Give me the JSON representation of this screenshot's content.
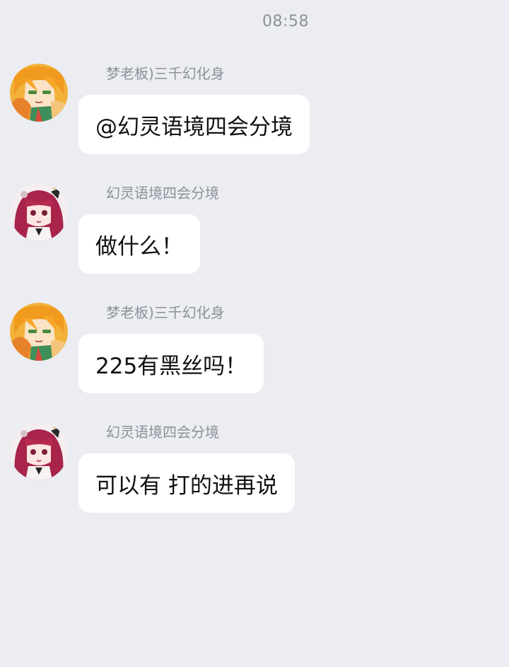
{
  "timestamp": "08:58",
  "messages": [
    {
      "sender": "梦老板)三千幻化身",
      "text": "@幻灵语境四会分境",
      "avatar": "orange-hair-anime-avatar-icon"
    },
    {
      "sender": "幻灵语境四会分境",
      "text": "做什么！",
      "avatar": "red-hair-anime-avatar-icon"
    },
    {
      "sender": "梦老板)三千幻化身",
      "text": "225有黑丝吗！",
      "avatar": "orange-hair-anime-avatar-icon"
    },
    {
      "sender": "幻灵语境四会分境",
      "text": "可以有 打的进再说",
      "avatar": "red-hair-anime-avatar-icon"
    }
  ],
  "colors": {
    "background": "#ebedf3",
    "bubble": "#ffffff",
    "meta_text": "#8d9097",
    "message_text": "#111111"
  }
}
